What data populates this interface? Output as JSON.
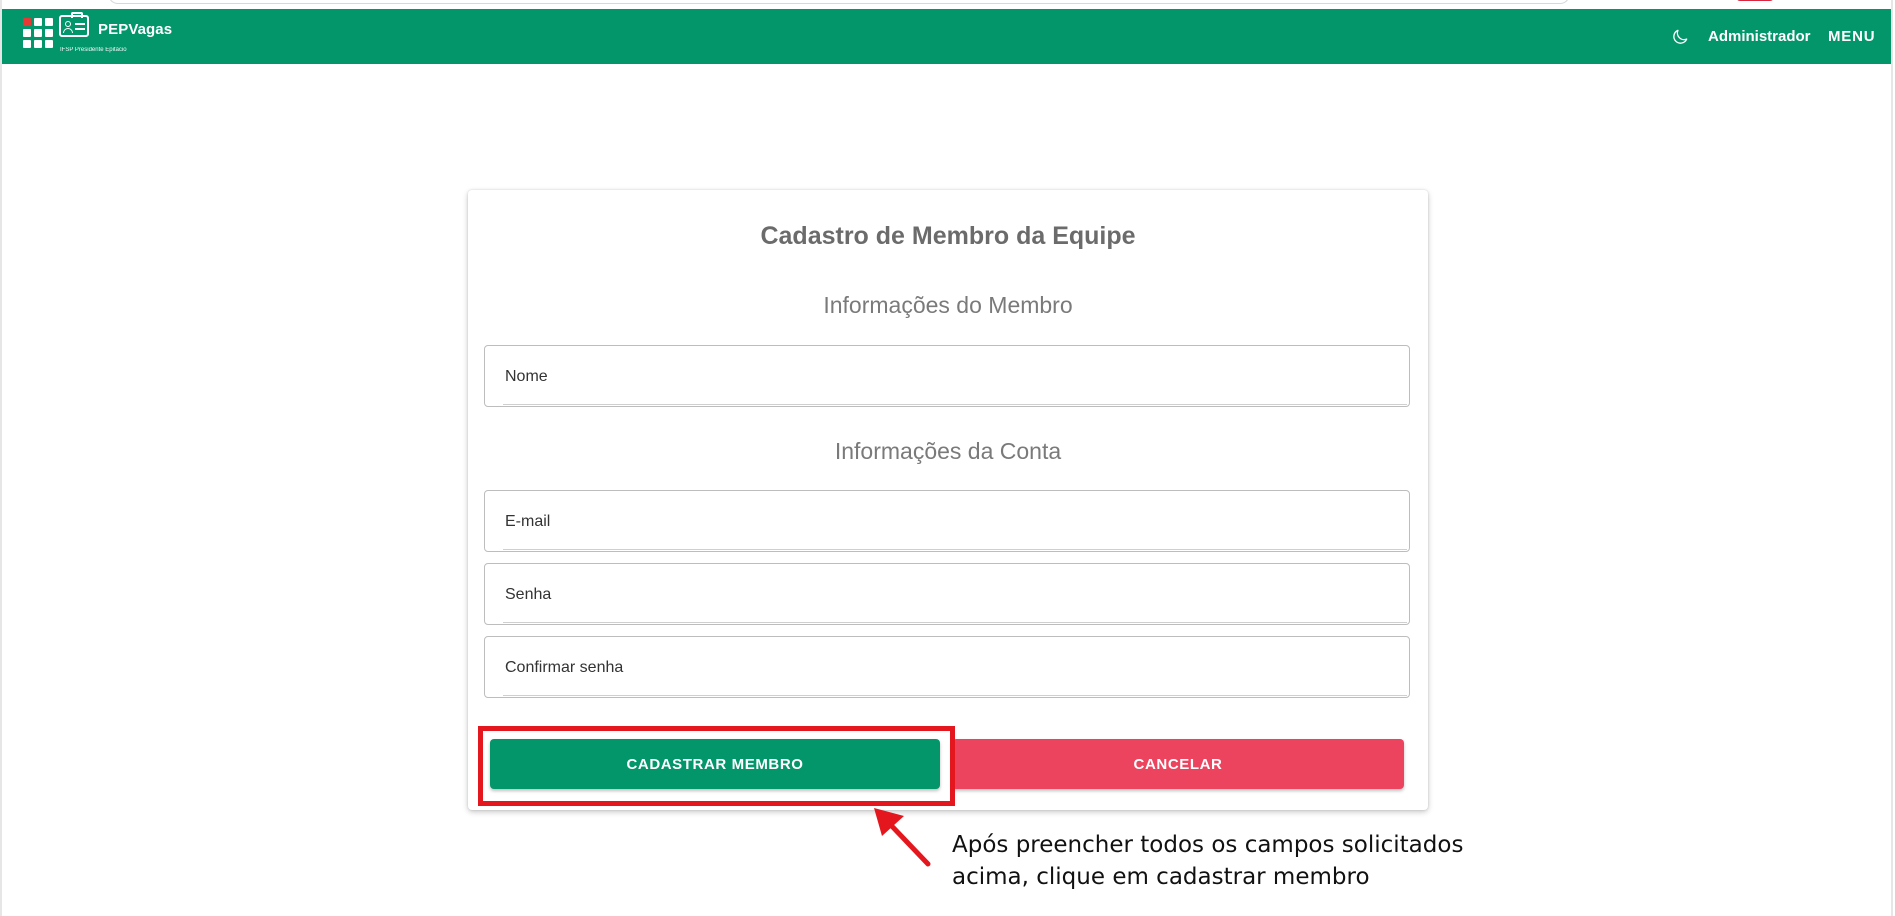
{
  "app": {
    "brand_name": "PEPVagas",
    "brand_subtitle": "IFSP Presidente Epitácio",
    "user_label": "Administrador",
    "menu_label": "MENU",
    "theme_icon": "moon-icon",
    "accent_color": "#03966b"
  },
  "form": {
    "title": "Cadastro de Membro da Equipe",
    "member_section_title": "Informações do Membro",
    "account_section_title": "Informações da Conta",
    "fields": {
      "name_placeholder": "Nome",
      "email_placeholder": "E-mail",
      "password_placeholder": "Senha",
      "confirm_password_placeholder": "Confirmar senha"
    },
    "submit_label": "CADASTRAR MEMBRO",
    "cancel_label": "CANCELAR",
    "cancel_color": "#ec445e"
  },
  "annotation": {
    "line1": "Após preencher todos os campos solicitados",
    "line2": "acima, clique em cadastrar membro",
    "highlight_color": "#e3171d"
  }
}
